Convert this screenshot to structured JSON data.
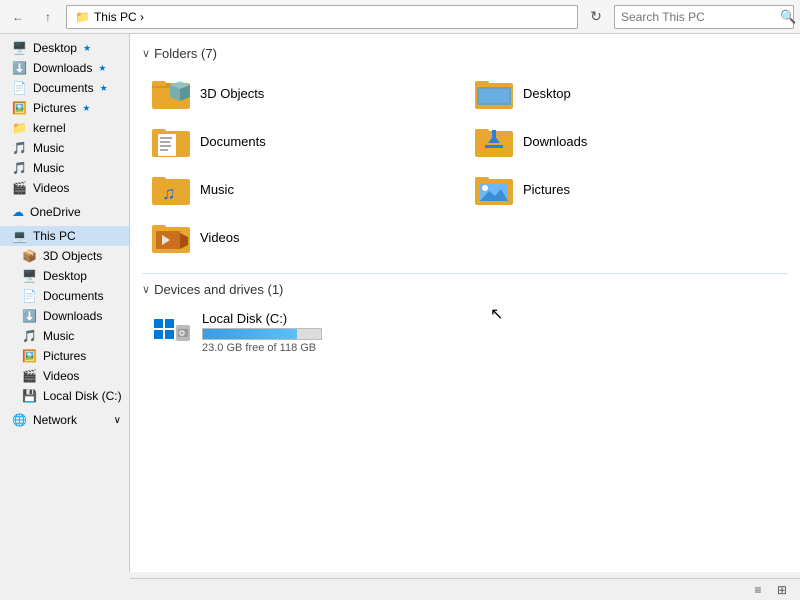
{
  "addressBar": {
    "path": "This PC",
    "pathFull": " This PC  ›",
    "searchPlaceholder": "Search This PC"
  },
  "sidebar": {
    "quickAccess": [
      {
        "id": "desktop",
        "label": "Desktop",
        "pinned": true
      },
      {
        "id": "downloads",
        "label": "Downloads",
        "pinned": true,
        "active": false
      },
      {
        "id": "documents",
        "label": "Documents",
        "pinned": true
      },
      {
        "id": "pictures",
        "label": "Pictures",
        "pinned": true
      },
      {
        "id": "kernel",
        "label": "kernel",
        "pinned": false
      },
      {
        "id": "music1",
        "label": "Music",
        "pinned": false
      },
      {
        "id": "music2",
        "label": "Music",
        "pinned": false
      },
      {
        "id": "videos1",
        "label": "Videos",
        "pinned": false
      }
    ],
    "onedrive": "OneDrive",
    "thisPC": {
      "label": "This PC",
      "active": true,
      "children": [
        {
          "id": "3dobjects",
          "label": "3D Objects"
        },
        {
          "id": "desktop2",
          "label": "Desktop"
        },
        {
          "id": "documents2",
          "label": "Documents"
        },
        {
          "id": "downloads2",
          "label": "Downloads"
        },
        {
          "id": "music3",
          "label": "Music"
        },
        {
          "id": "pictures2",
          "label": "Pictures"
        },
        {
          "id": "videos2",
          "label": "Videos"
        },
        {
          "id": "localdisk",
          "label": "Local Disk (C:)"
        }
      ]
    },
    "network": "Network"
  },
  "content": {
    "foldersHeader": "Folders (7)",
    "folders": [
      {
        "id": "3dobjects",
        "label": "3D Objects",
        "type": "3d"
      },
      {
        "id": "desktop",
        "label": "Desktop",
        "type": "desktop"
      },
      {
        "id": "documents",
        "label": "Documents",
        "type": "documents"
      },
      {
        "id": "downloads",
        "label": "Downloads",
        "type": "downloads"
      },
      {
        "id": "music",
        "label": "Music",
        "type": "music"
      },
      {
        "id": "pictures",
        "label": "Pictures",
        "type": "pictures"
      },
      {
        "id": "videos",
        "label": "Videos",
        "type": "videos"
      }
    ],
    "devicesHeader": "Devices and drives (1)",
    "drives": [
      {
        "id": "localdisk",
        "label": "Local Disk (C:)",
        "freeSpace": "23.0 GB free of 118 GB",
        "totalGB": 118,
        "freeGB": 23,
        "usedPercent": 80
      }
    ]
  },
  "statusBar": {
    "viewIcons": [
      "list-view-icon",
      "details-view-icon"
    ]
  }
}
